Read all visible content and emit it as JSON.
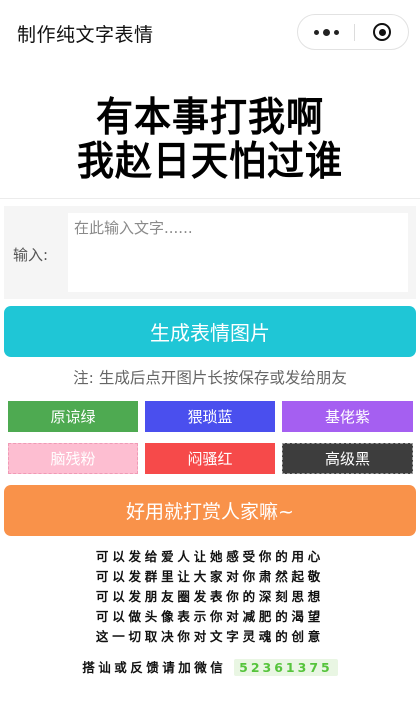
{
  "header": {
    "title": "制作纯文字表情"
  },
  "preview": {
    "line1": "有本事打我啊",
    "line2": "我赵日天怕过谁"
  },
  "input": {
    "label": "输入:",
    "placeholder": "在此输入文字......",
    "value": ""
  },
  "generate_label": "生成表情图片",
  "note": "注: 生成后点开图片长按保存或发给朋友",
  "styles": [
    {
      "label": "原谅绿",
      "color": "#4eaa51"
    },
    {
      "label": "猥琐蓝",
      "color": "#4a4fee"
    },
    {
      "label": "基佬紫",
      "color": "#a55ff1"
    },
    {
      "label": "脑残粉",
      "color": "#fdbed1"
    },
    {
      "label": "闷骚红",
      "color": "#f64a4a"
    },
    {
      "label": "高级黑",
      "color": "#3d3d3d"
    }
  ],
  "tip_label": "好用就打赏人家嘛~",
  "promo": [
    "可以发给爱人让她感受你的用心",
    "可以发群里让大家对你肃然起敬",
    "可以发朋友圈发表你的深刻思想",
    "可以做头像表示你对减肥的渴望",
    "这一切取决你对文字灵魂的创意"
  ],
  "contact": {
    "text": "搭讪或反馈请加微信",
    "wechat": "52361375"
  },
  "colors": {
    "generate": "#1fc6d6",
    "tip": "#f9924a",
    "wechat_highlight": "#56c43c"
  }
}
